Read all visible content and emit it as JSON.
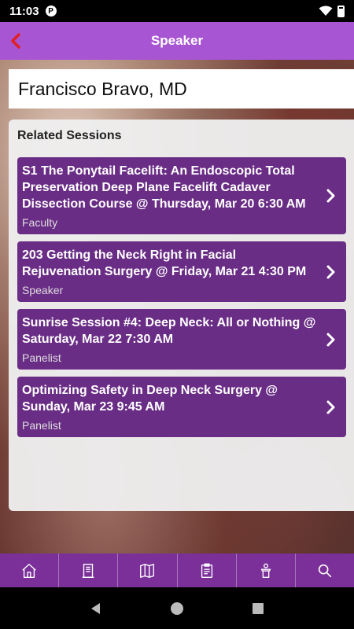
{
  "status_bar": {
    "time": "11:03",
    "app_icon_letter": "P"
  },
  "header": {
    "title": "Speaker",
    "back_icon": "chevron-left-icon"
  },
  "speaker": {
    "name": "Francisco Bravo, MD"
  },
  "related_sessions": {
    "title": "Related Sessions",
    "items": [
      {
        "title": "S1 The Ponytail Facelift: An Endoscopic Total Preservation Deep Plane Facelift Cadaver Dissection Course @ Thursday, Mar 20 6:30 AM",
        "role": "Faculty"
      },
      {
        "title": "203 Getting the Neck Right in Facial Rejuvenation Surgery @ Friday, Mar 21 4:30 PM",
        "role": "Speaker"
      },
      {
        "title": "Sunrise Session #4: Deep Neck: All or Nothing @ Saturday, Mar 22 7:30 AM",
        "role": "Panelist"
      },
      {
        "title": "Optimizing Safety in Deep Neck Surgery @ Sunday, Mar 23 9:45 AM",
        "role": "Panelist"
      }
    ]
  },
  "bottom_nav": [
    "home-icon",
    "building-icon",
    "map-icon",
    "schedule-icon",
    "speaker-podium-icon",
    "search-icon"
  ],
  "colors": {
    "header": "#a855d4",
    "session_card": "#6a2d86",
    "bottom_nav": "#7a2f99",
    "back_arrow": "#e02020"
  }
}
